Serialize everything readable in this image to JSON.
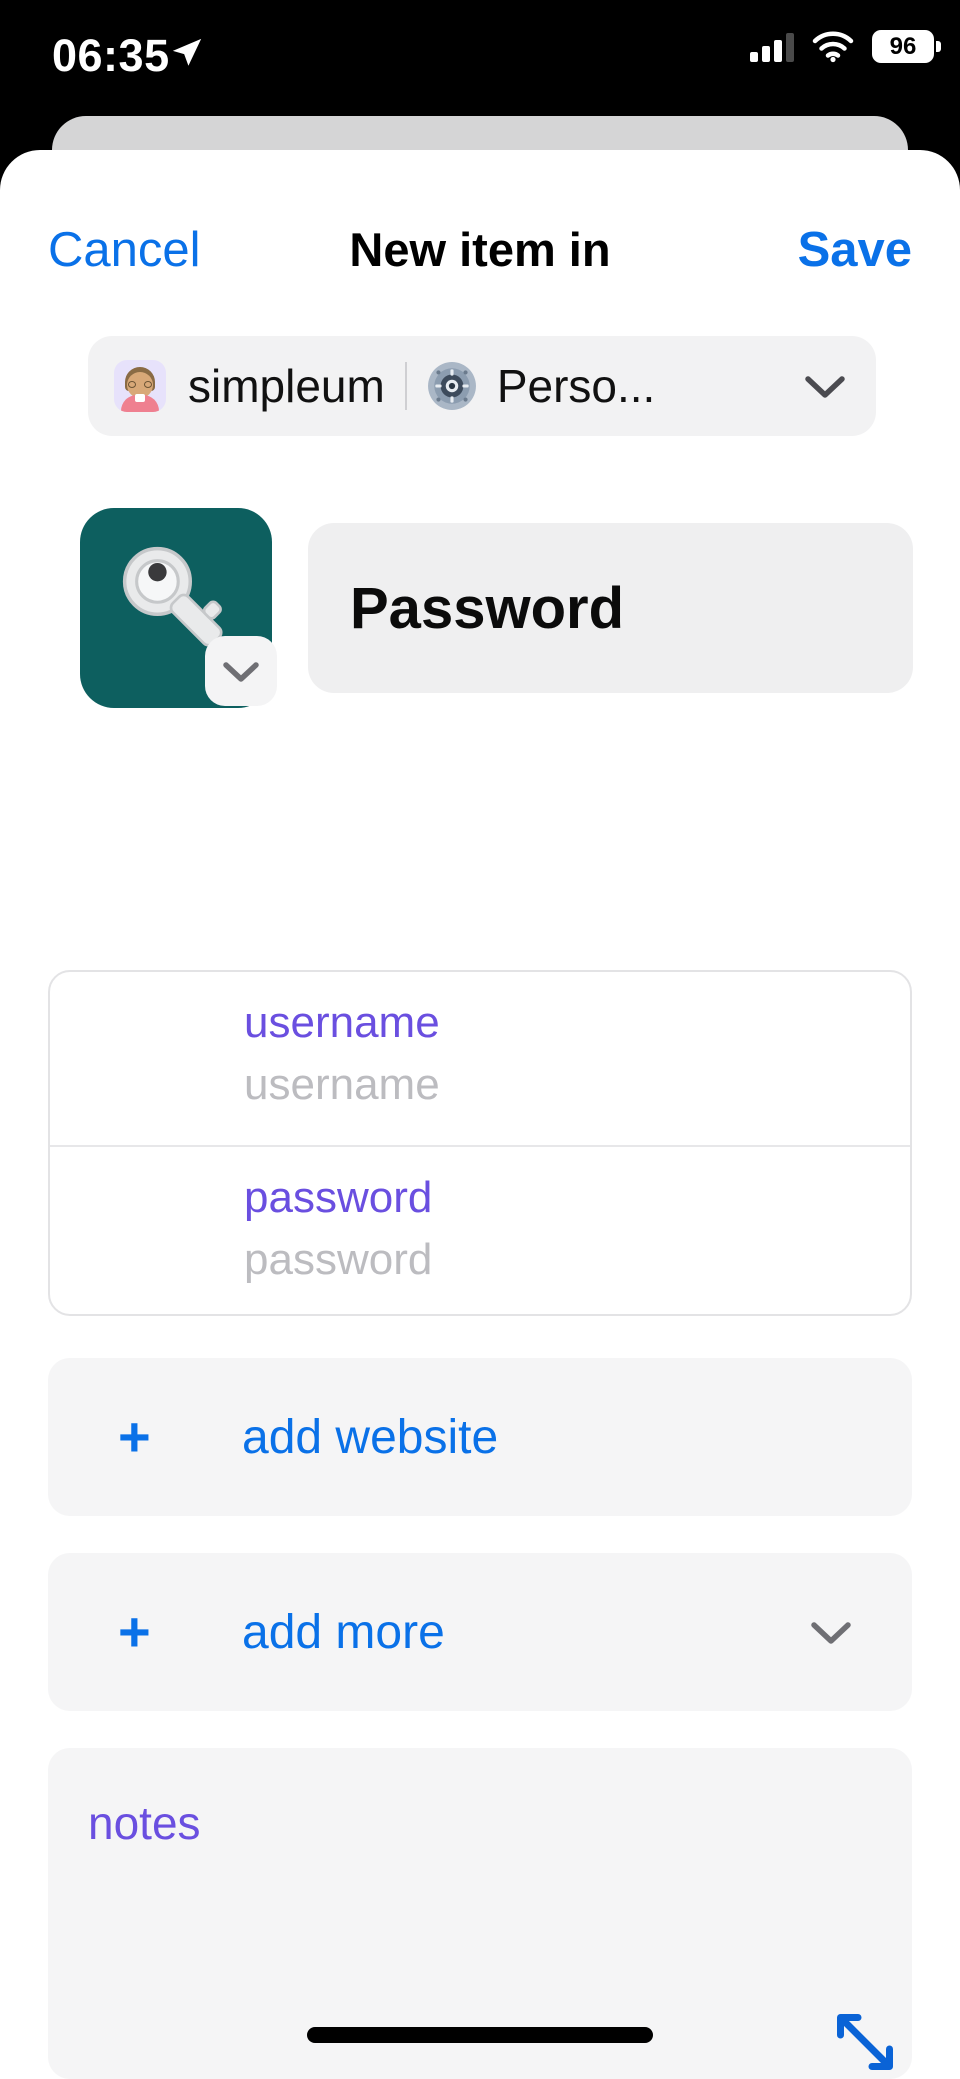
{
  "status_bar": {
    "time": "06:35",
    "location_icon": "location-arrow-icon",
    "signal_icon": "cellular-signal-icon",
    "signal_bars_filled": 3,
    "signal_bars_total": 4,
    "wifi_icon": "wifi-icon",
    "battery_level": "96",
    "battery_icon": "battery-icon"
  },
  "navbar": {
    "cancel_label": "Cancel",
    "title": "New item in",
    "save_label": "Save"
  },
  "account_chip": {
    "avatar_icon": "person-with-glasses-avatar",
    "account_name": "simpleum",
    "vault_icon": "vault-dial-icon",
    "vault_name": "Perso...",
    "chevron_icon": "chevron-down-icon"
  },
  "item_type": {
    "type_icon": "key-icon",
    "type_icon_background": "#0d5f5f",
    "type_chevron_icon": "chevron-down-icon",
    "title_value": "Password"
  },
  "fields": [
    {
      "label": "username",
      "placeholder": "username",
      "value": ""
    },
    {
      "label": "password",
      "placeholder": "password",
      "value": ""
    }
  ],
  "actions": {
    "add_website": {
      "plus_icon": "plus-icon",
      "label": "add website"
    },
    "add_more": {
      "plus_icon": "plus-icon",
      "label": "add more",
      "chevron_icon": "chevron-down-icon"
    }
  },
  "notes": {
    "label": "notes",
    "value": ""
  },
  "bottom": {
    "home_indicator": "home-indicator",
    "resize_icon": "resize-diagonal-icon"
  },
  "colors": {
    "accent_blue": "#0a71e8",
    "label_purple": "#6a4fe0",
    "placeholder_gray": "#bcbcc0",
    "card_gray": "#f5f5f6",
    "key_tile_teal": "#0d5f5f"
  }
}
